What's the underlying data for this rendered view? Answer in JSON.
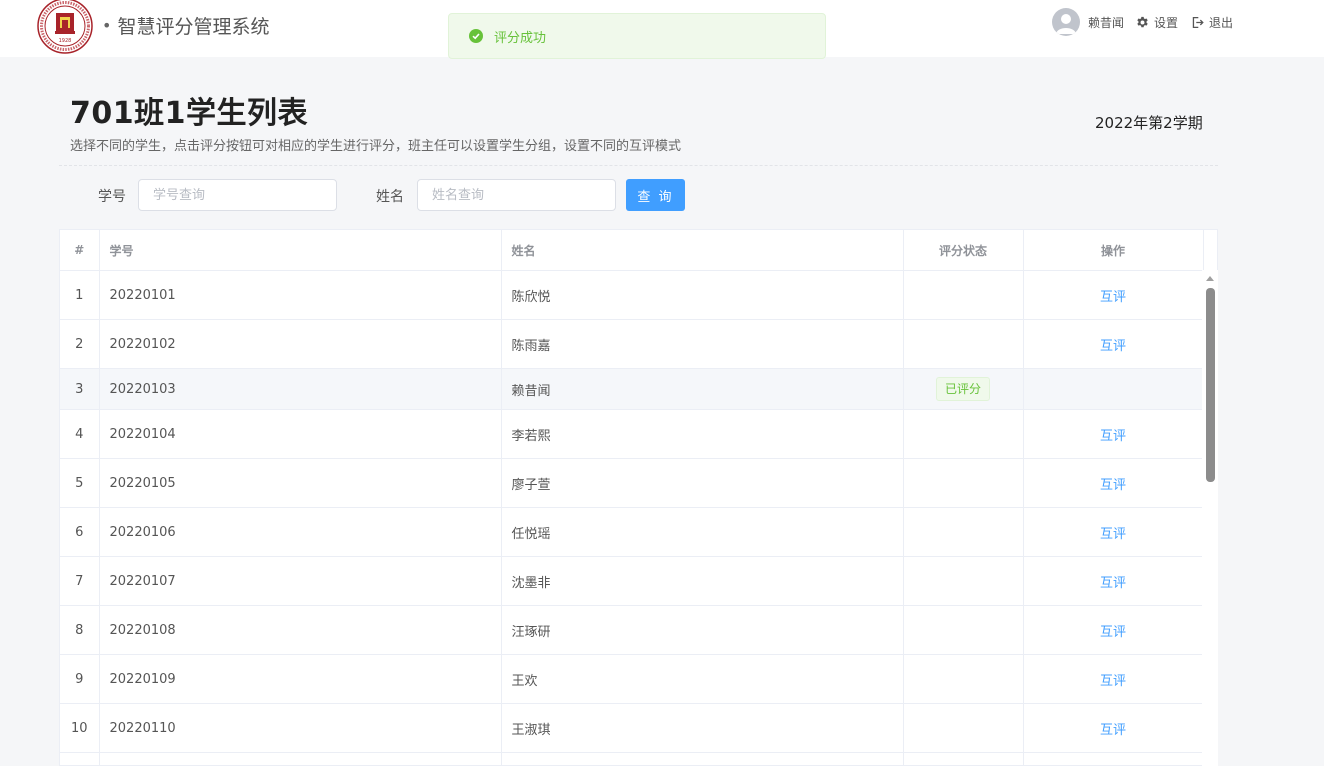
{
  "header": {
    "app_title": "智慧评分管理系统",
    "username": "赖昔闻",
    "settings_label": "设置",
    "logout_label": "退出"
  },
  "toast": {
    "message": "评分成功"
  },
  "page": {
    "title": "701班1学生列表",
    "subtitle": "选择不同的学生，点击评分按钮可对相应的学生进行评分，班主任可以设置学生分组，设置不同的互评模式",
    "term": "2022年第2学期"
  },
  "filters": {
    "student_id_label": "学号",
    "student_id_placeholder": "学号查询",
    "name_label": "姓名",
    "name_placeholder": "姓名查询",
    "query_button": "查 询"
  },
  "table": {
    "columns": {
      "index": "#",
      "student_id": "学号",
      "name": "姓名",
      "status": "评分状态",
      "action": "操作"
    },
    "rows": [
      {
        "index": "1",
        "student_id": "20220101",
        "name": "陈欣悦",
        "status": "",
        "action": "互评"
      },
      {
        "index": "2",
        "student_id": "20220102",
        "name": "陈雨嘉",
        "status": "",
        "action": "互评"
      },
      {
        "index": "3",
        "student_id": "20220103",
        "name": "赖昔闻",
        "status": "已评分",
        "action": ""
      },
      {
        "index": "4",
        "student_id": "20220104",
        "name": "李若熙",
        "status": "",
        "action": "互评"
      },
      {
        "index": "5",
        "student_id": "20220105",
        "name": "廖子萱",
        "status": "",
        "action": "互评"
      },
      {
        "index": "6",
        "student_id": "20220106",
        "name": "任悦瑶",
        "status": "",
        "action": "互评"
      },
      {
        "index": "7",
        "student_id": "20220107",
        "name": "沈墨非",
        "status": "",
        "action": "互评"
      },
      {
        "index": "8",
        "student_id": "20220108",
        "name": "汪琢研",
        "status": "",
        "action": "互评"
      },
      {
        "index": "9",
        "student_id": "20220109",
        "name": "王欢",
        "status": "",
        "action": "互评"
      },
      {
        "index": "10",
        "student_id": "20220110",
        "name": "王淑琪",
        "status": "",
        "action": "互评"
      },
      {
        "index": "",
        "student_id": "",
        "name": "",
        "status": "",
        "action": ""
      }
    ]
  },
  "colors": {
    "accent": "#409eff",
    "success": "#67c23a",
    "success_bg": "#f0f9eb",
    "logo_red": "#a8232a"
  },
  "icons": {
    "toast": "check-circle-icon",
    "avatar": "user-icon",
    "settings": "gear-icon",
    "logout": "logout-icon",
    "logo": "school-emblem-icon"
  }
}
